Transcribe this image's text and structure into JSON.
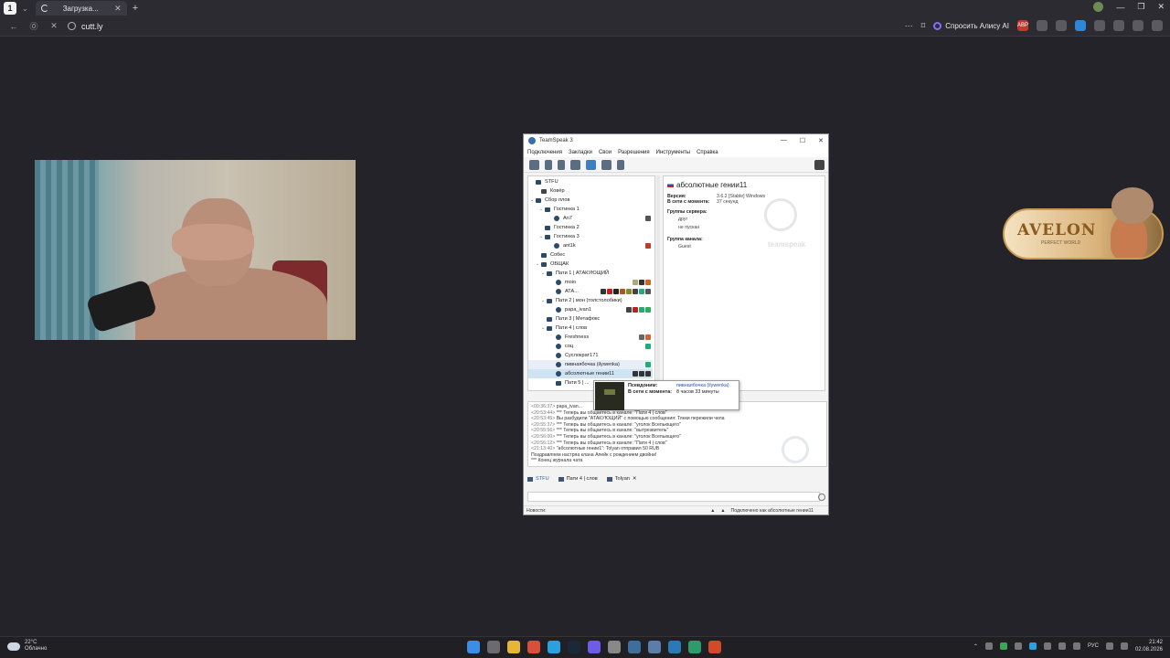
{
  "browser": {
    "tab_title": "Загрузка...",
    "url": "cutt.ly",
    "alisa_label": "Спросить Алису AI",
    "abp_label": "ABP"
  },
  "banner": {
    "logo": "AVELON",
    "sub": "PERFECT WORLD"
  },
  "ts": {
    "window_title": "TeamSpeak 3",
    "menu": [
      "Подключения",
      "Закладки",
      "Свои",
      "Разрешения",
      "Инструменты",
      "Справка"
    ],
    "tree": [
      {
        "label": "STFU",
        "kind": "server"
      },
      {
        "label": "Ковёр",
        "kind": "channel"
      },
      {
        "label": "Сбор плов",
        "kind": "channel"
      },
      {
        "label": "Гостинка 1",
        "kind": "channel"
      },
      {
        "label": "An7",
        "kind": "user"
      },
      {
        "label": "Гостинка 2",
        "kind": "channel"
      },
      {
        "label": "Гостинка 3",
        "kind": "channel"
      },
      {
        "label": "ant1k",
        "kind": "user"
      },
      {
        "label": "Собес",
        "kind": "channel"
      },
      {
        "label": "ОБЩАК",
        "kind": "channel"
      },
      {
        "label": "Пати 1 | АТАКУЮЩИЙ",
        "kind": "channel"
      },
      {
        "label": "moio",
        "kind": "user"
      },
      {
        "label": "АТА...",
        "kind": "user"
      },
      {
        "label": "Пати 2 | мон (толстолобики)",
        "kind": "channel"
      },
      {
        "label": "papa_ivan1",
        "kind": "user"
      },
      {
        "label": "Пати 3 | Метафокс",
        "kind": "channel"
      },
      {
        "label": "Пати 4 | слов",
        "kind": "channel"
      },
      {
        "label": "Freshness",
        "kind": "user"
      },
      {
        "label": "соц",
        "kind": "user"
      },
      {
        "label": "Суслократ171",
        "kind": "user"
      },
      {
        "label": "пивнаябочка (ilywenka)",
        "kind": "user"
      },
      {
        "label": "абсолютные гении11",
        "kind": "user"
      },
      {
        "label": "Пати 5 | ...",
        "kind": "channel"
      }
    ],
    "info": {
      "username": "абсолютные гении11",
      "version_label": "Версия:",
      "version_value": "3.6.2 [Stable] Windows",
      "online_label": "В сети с момента:",
      "online_value": "37 секунд",
      "server_groups_label": "Группы сервера:",
      "server_groups": [
        "друг",
        "не пускан"
      ],
      "channel_group_label": "Группа канала:",
      "channel_group": "Guest",
      "watermark": "teamspeak"
    },
    "tooltip": {
      "nick_label": "Псевдоним:",
      "nick_value": "пивнаябочка (ilywenka)",
      "online_label": "В сети с момента:",
      "online_value": "8 часов 33 минуты"
    },
    "chat": [
      {
        "time": "<00:36:37>",
        "text": "papa_ivan..."
      },
      {
        "time": "<20:53:44>",
        "text": "*** Теперь вы общаетесь в канале: \"Пати 4 | слов\""
      },
      {
        "time": "<20:53:45>",
        "text": "Вы разбудили \"АТАКУЮЩИЙ\" с помощью сообщения: Тянки пережили чела"
      },
      {
        "time": "<20:55:37>",
        "text": "*** Теперь вы общаетесь в канале: \"уголок Всепьющего\""
      },
      {
        "time": "<20:55:56>",
        "text": "*** Теперь вы общаетесь в канале: \"вытрезвитель\""
      },
      {
        "time": "<20:56:00>",
        "text": "*** Теперь вы общаетесь в канале: \"уголок Всепьющего\""
      },
      {
        "time": "<20:56:12>",
        "text": "*** Теперь вы общаетесь в канале: \"Пати 4 | слов\""
      },
      {
        "time": "<21:13:40>",
        "text": "\"абсолютные гении1\": Tolyan отправил 50 RUB"
      },
      {
        "time": "",
        "text": "Поздравляем настряа клана Апейк с рождением двойни!"
      },
      {
        "time": "",
        "text": "*** Конец журнала чата"
      }
    ],
    "tabs": [
      "STFU",
      "Пати 4 | слов",
      "Tolyan"
    ],
    "status_left": "Новости:",
    "status_right": "Подключено как абсолютные гении11"
  },
  "taskbar": {
    "temp": "22°C",
    "weather": "Облачно",
    "lang": "РУС",
    "time": "21:42",
    "date": "02.08.2026"
  }
}
